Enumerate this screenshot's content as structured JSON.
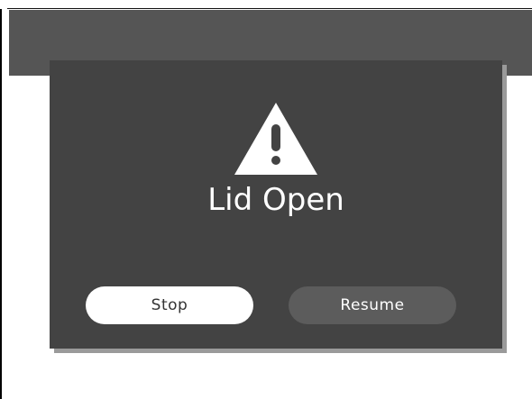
{
  "dialog": {
    "icon": "warning-icon",
    "title": "Lid Open",
    "stop_label": "Stop",
    "resume_label": "Resume"
  },
  "colors": {
    "top_bar": "#555555",
    "dialog_bg": "#434343",
    "stop_button_bg": "#ffffff",
    "resume_button_bg": "#5c5c5c"
  }
}
